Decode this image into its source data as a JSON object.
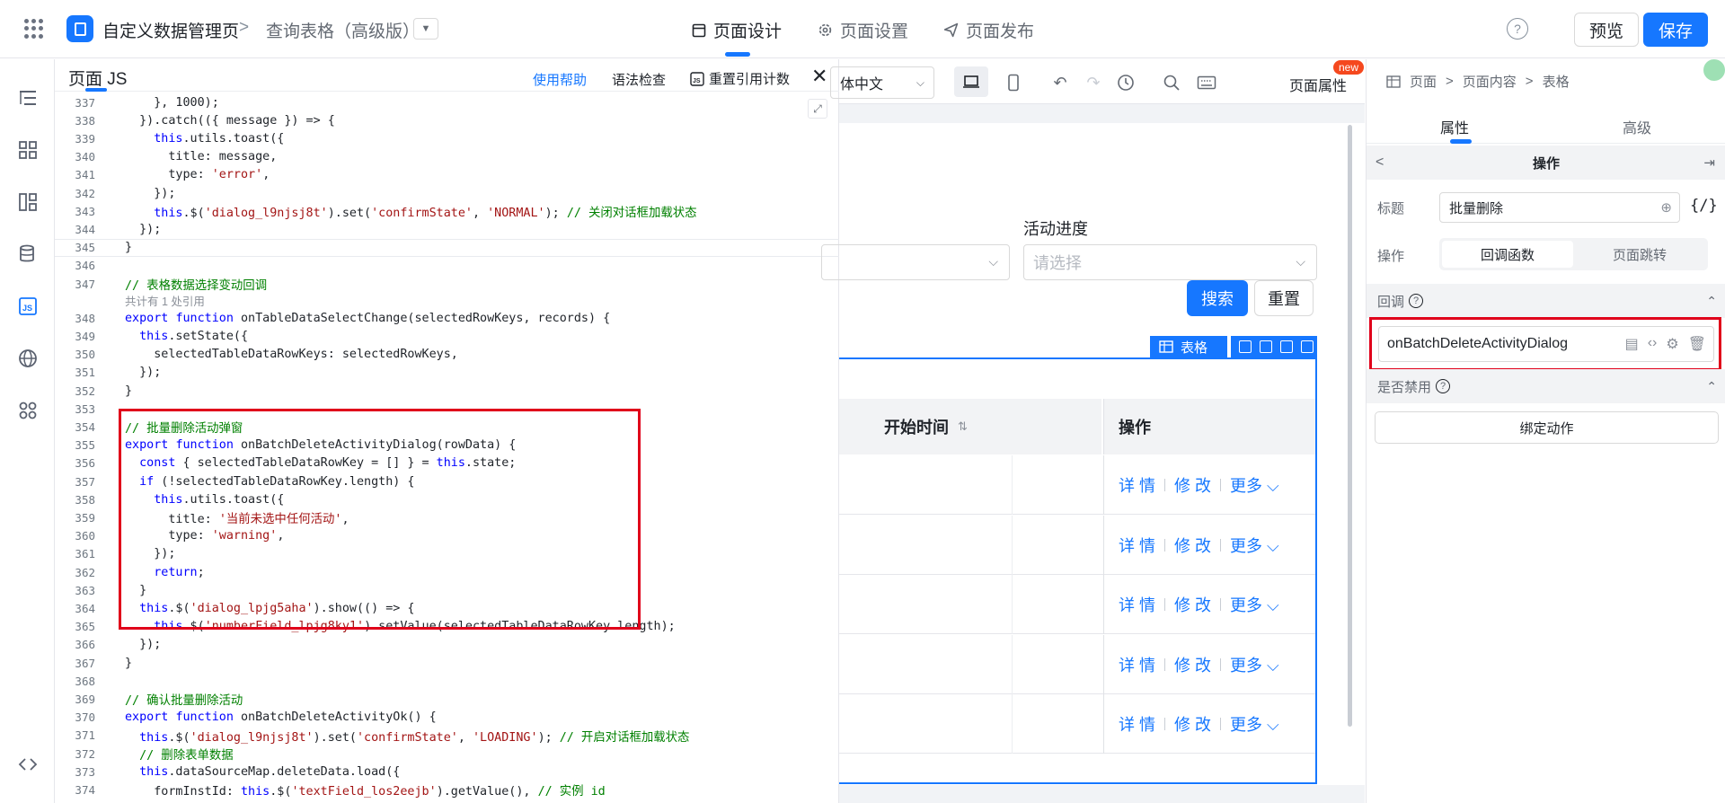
{
  "app": {
    "title": "自定义数据管理页",
    "page_name": "查询表格（高级版）"
  },
  "center_tabs": [
    {
      "label": "页面设计"
    },
    {
      "label": "页面设置"
    },
    {
      "label": "页面发布"
    }
  ],
  "actions": {
    "preview": "预览",
    "save": "保存",
    "help": "?"
  },
  "editor": {
    "title": "页面 JS",
    "help_link": "使用帮助",
    "syntax_check": "语法检查",
    "reset_ref_count": "重置引用计数",
    "reference_note": "共计有 1 处引用",
    "lines": [
      {
        "n": "337",
        "text": "    }, 1000);"
      },
      {
        "n": "338",
        "text": "  }).catch(({ message }) => {"
      },
      {
        "n": "339",
        "text": "    this.utils.toast({"
      },
      {
        "n": "340",
        "text": "      title: message,"
      },
      {
        "n": "341",
        "text": "      type: 'error',"
      },
      {
        "n": "342",
        "text": "    });"
      },
      {
        "n": "343",
        "text": "    this.$('dialog_l9njsj8t').set('confirmState', 'NORMAL'); // 关闭对话框加载状态"
      },
      {
        "n": "344",
        "text": "  });"
      },
      {
        "n": "345",
        "text": "}"
      },
      {
        "n": "346",
        "text": ""
      },
      {
        "n": "347",
        "text": "// 表格数据选择变动回调"
      },
      {
        "n": "348",
        "text": "export function onTableDataSelectChange(selectedRowKeys, records) {"
      },
      {
        "n": "349",
        "text": "  this.setState({"
      },
      {
        "n": "350",
        "text": "    selectedTableDataRowKeys: selectedRowKeys,"
      },
      {
        "n": "351",
        "text": "  });"
      },
      {
        "n": "352",
        "text": "}"
      },
      {
        "n": "353",
        "text": ""
      },
      {
        "n": "354",
        "text": "// 批量删除活动弹窗"
      },
      {
        "n": "355",
        "text": "export function onBatchDeleteActivityDialog(rowData) {"
      },
      {
        "n": "356",
        "text": "  const { selectedTableDataRowKey = [] } = this.state;"
      },
      {
        "n": "357",
        "text": "  if (!selectedTableDataRowKey.length) {"
      },
      {
        "n": "358",
        "text": "    this.utils.toast({"
      },
      {
        "n": "359",
        "text": "      title: '当前未选中任何活动',"
      },
      {
        "n": "360",
        "text": "      type: 'warning',"
      },
      {
        "n": "361",
        "text": "    });"
      },
      {
        "n": "362",
        "text": "    return;"
      },
      {
        "n": "363",
        "text": "  }"
      },
      {
        "n": "364",
        "text": "  this.$('dialog_lpjg5aha').show(() => {"
      },
      {
        "n": "365",
        "text": "    this.$('numberField_lpjg8ky1').setValue(selectedTableDataRowKey.length);"
      },
      {
        "n": "366",
        "text": "  });"
      },
      {
        "n": "367",
        "text": "}"
      },
      {
        "n": "368",
        "text": ""
      },
      {
        "n": "369",
        "text": "// 确认批量删除活动"
      },
      {
        "n": "370",
        "text": "export function onBatchDeleteActivityOk() {"
      },
      {
        "n": "371",
        "text": "  this.$('dialog_l9njsj8t').set('confirmState', 'LOADING'); // 开启对话框加载状态"
      },
      {
        "n": "372",
        "text": "  // 删除表单数据"
      },
      {
        "n": "373",
        "text": "  this.dataSourceMap.deleteData.load({"
      },
      {
        "n": "374",
        "text": "    formInstId: this.$('textField_los2eejb').getValue(), // 实例 id"
      }
    ]
  },
  "canvas": {
    "language": "体中文",
    "page_props": "页面属性",
    "new_badge": "new",
    "filter_label": "活动进度",
    "placeholder": "请选择",
    "search_btn": "搜索",
    "reset_btn": "重置",
    "table_tag": "表格",
    "col_start_time": "开始时间",
    "col_actions": "操作",
    "row_actions": {
      "detail": "详 情",
      "edit": "修 改",
      "more": "更多"
    }
  },
  "props": {
    "breadcrumb": [
      "页面",
      "页面内容",
      "表格"
    ],
    "tabs": [
      "属性",
      "高级"
    ],
    "section_title": "操作",
    "title_label": "标题",
    "title_value": "批量删除",
    "expr_btn": "{/}",
    "action_label": "操作",
    "action_options": [
      "回调函数",
      "页面跳转"
    ],
    "callback_label": "回调",
    "callback_value": "onBatchDeleteActivityDialog",
    "disabled_label": "是否禁用",
    "bind_action": "绑定动作"
  },
  "colors": {
    "accent": "#1677ff",
    "highlight_box": "#e0001a",
    "keyword": "#0000ff",
    "string": "#a31515",
    "comment": "#008000"
  }
}
